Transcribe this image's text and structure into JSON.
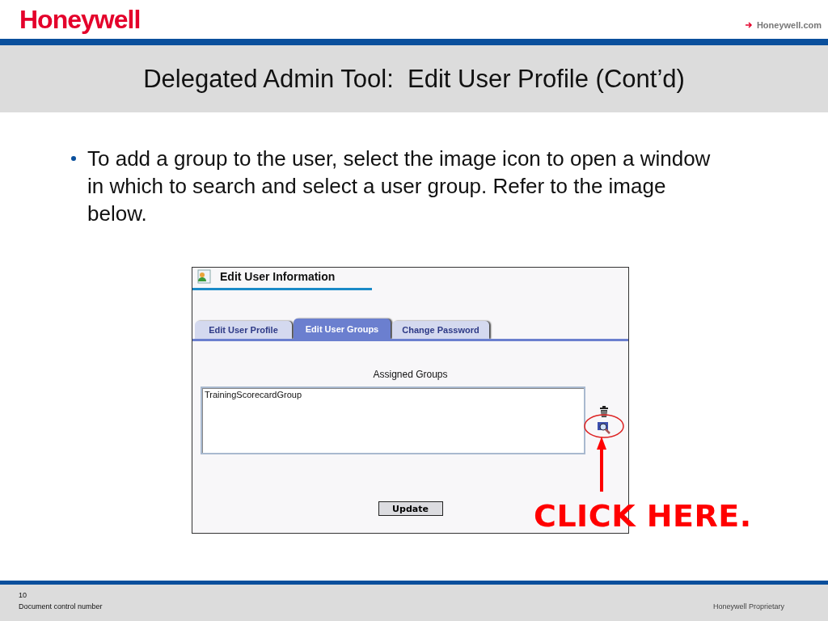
{
  "header": {
    "logo": "Honeywell",
    "link": "Honeywell.com"
  },
  "title": "Delegated Admin Tool:  Edit User Profile (Cont’d)",
  "bullets": [
    "To add a group to the user, select the image icon to open a window in which to search and select a user group. Refer to the image below."
  ],
  "screenshot": {
    "title": "Edit User Information",
    "tabs": [
      {
        "label": "Edit User Profile",
        "selected": false
      },
      {
        "label": "Edit User Groups",
        "selected": true
      },
      {
        "label": "Change Password",
        "selected": false
      }
    ],
    "list_label": "Assigned Groups",
    "list_items": [
      "TrainingScorecardGroup"
    ],
    "update_button": "Update"
  },
  "callout": "CLICK HERE.",
  "footer": {
    "page_number": "10",
    "document": "Document control number",
    "classification": "Honeywell Proprietary"
  }
}
